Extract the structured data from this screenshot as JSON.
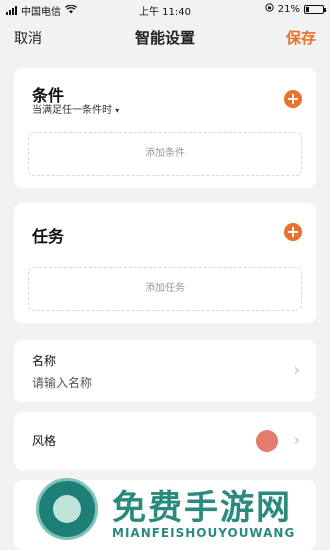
{
  "status_bar": {
    "carrier": "中国电信",
    "time": "上午 11:40",
    "battery_percent": "21%",
    "battery_level": 0.21
  },
  "nav": {
    "cancel": "取消",
    "title": "智能设置",
    "save": "保存"
  },
  "condition": {
    "title": "条件",
    "subtitle": "当满足任一条件时",
    "add": "添加条件"
  },
  "task": {
    "title": "任务",
    "add": "添加任务"
  },
  "name": {
    "label": "名称",
    "placeholder": "请输入名称"
  },
  "style": {
    "label": "风格",
    "swatch_color": "#e57a6e"
  },
  "watermark": {
    "cn": "免费手游网",
    "en": "MIANFEISHOUYOUWANG"
  },
  "colors": {
    "accent": "#e8722b"
  }
}
